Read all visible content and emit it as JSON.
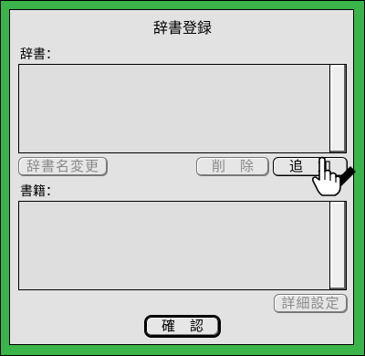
{
  "dialog": {
    "title": "辞書登録",
    "dictionary_label": "辞書：",
    "books_label": "書籍："
  },
  "buttons": {
    "rename": "辞書名変更",
    "delete": "削除",
    "add": "追加",
    "details": "詳細設定",
    "confirm": "確認"
  },
  "state": {
    "rename_enabled": false,
    "delete_enabled": false,
    "add_enabled": true,
    "details_enabled": false,
    "confirm_enabled": true
  },
  "colors": {
    "frame": "#3bb44a",
    "dialog_bg": "#e2e2e2",
    "disabled_text": "#8a8a8a"
  },
  "icons": {
    "cursor": "pointing-hand-with-pen-icon"
  }
}
